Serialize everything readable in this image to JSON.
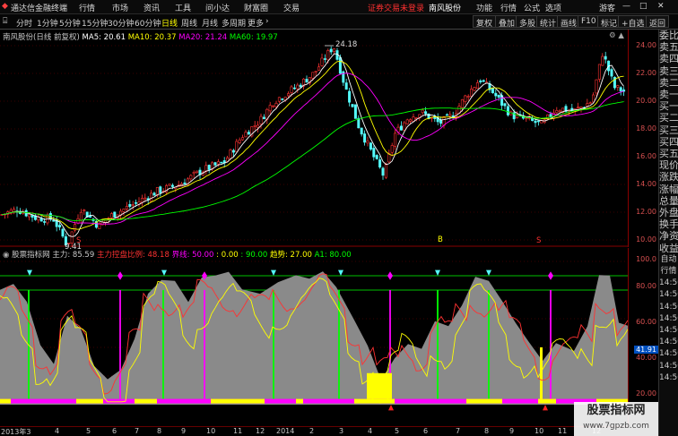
{
  "menu": {
    "app_title": "通达信金融终端",
    "items": [
      "行情",
      "市场",
      "资讯",
      "工具",
      "问小达",
      "财富圈",
      "交易"
    ],
    "notice": "证券交易未登录",
    "stock_name": "南风股份",
    "right_items": [
      "功能",
      "行情",
      "公式",
      "选项"
    ],
    "guest": "游客"
  },
  "toolbar": {
    "periods": [
      "分时",
      "1分钟",
      "5分钟",
      "15分钟",
      "30分钟",
      "60分钟",
      "日线",
      "周线",
      "月线",
      "多周期",
      "更多"
    ],
    "active_period": "日线",
    "buttons": [
      "复权",
      "叠加",
      "多股",
      "统计",
      "画线",
      "F10",
      "标记",
      "+自选"
    ],
    "back_label": "返回"
  },
  "main_chart": {
    "legend_title": "南风股份(日线 前复权)",
    "ma5": "MA5: 20.61",
    "ma10": "MA10: 20.37",
    "ma20": "MA20: 21.24",
    "ma60": "MA60: 19.97",
    "high_label": "24.18",
    "low_label": "9.41",
    "marker_labels": [
      "S",
      "B",
      "S"
    ],
    "price_axis": [
      "24.00",
      "22.00",
      "20.00",
      "18.00",
      "16.00",
      "14.00",
      "12.00",
      "10.00"
    ],
    "current_price": "20.00"
  },
  "indicator": {
    "name": "股票指标网",
    "zl": "主力: 85.59",
    "zlkp": "主力控盘比例: 48.18",
    "jx": "界线: 50.00",
    "v0": ": 0.00",
    "v90": ": 90.00",
    "qs": "趋势: 27.00",
    "a1": "A1: 80.00",
    "axis": [
      "100.0",
      "80.00",
      "60.00",
      "40.00",
      "20.00"
    ],
    "current_value": "41.91"
  },
  "dates": [
    "2013年3",
    "4",
    "5",
    "6",
    "7",
    "8",
    "9",
    "10",
    "11",
    "12",
    "2014",
    "2",
    "3",
    "4",
    "5",
    "6",
    "7",
    "8",
    "9",
    "10",
    "11",
    "12"
  ],
  "side_tabs": [
    "委比",
    "卖五",
    "卖四",
    "卖三",
    "卖二",
    "卖一",
    "买一",
    "买二",
    "买三",
    "买四",
    "买五",
    "现价",
    "涨跌",
    "涨幅",
    "总量",
    "外盘",
    "换手",
    "净资",
    "收益",
    "自动",
    "行情",
    "14:50",
    "14:50",
    "14:50",
    "14:50",
    "14:50",
    "14:50",
    "14:50",
    "14:50",
    "14:50"
  ],
  "watermark": {
    "title": "股票指标网",
    "url": "www.7gpzb.com"
  },
  "colors": {
    "up": "#ff3232",
    "down": "#54fcfc",
    "ma5": "#ffffff",
    "ma10": "#ffff00",
    "ma20": "#ff00ff",
    "ma60": "#00ff00",
    "accent": "#ffff00"
  }
}
